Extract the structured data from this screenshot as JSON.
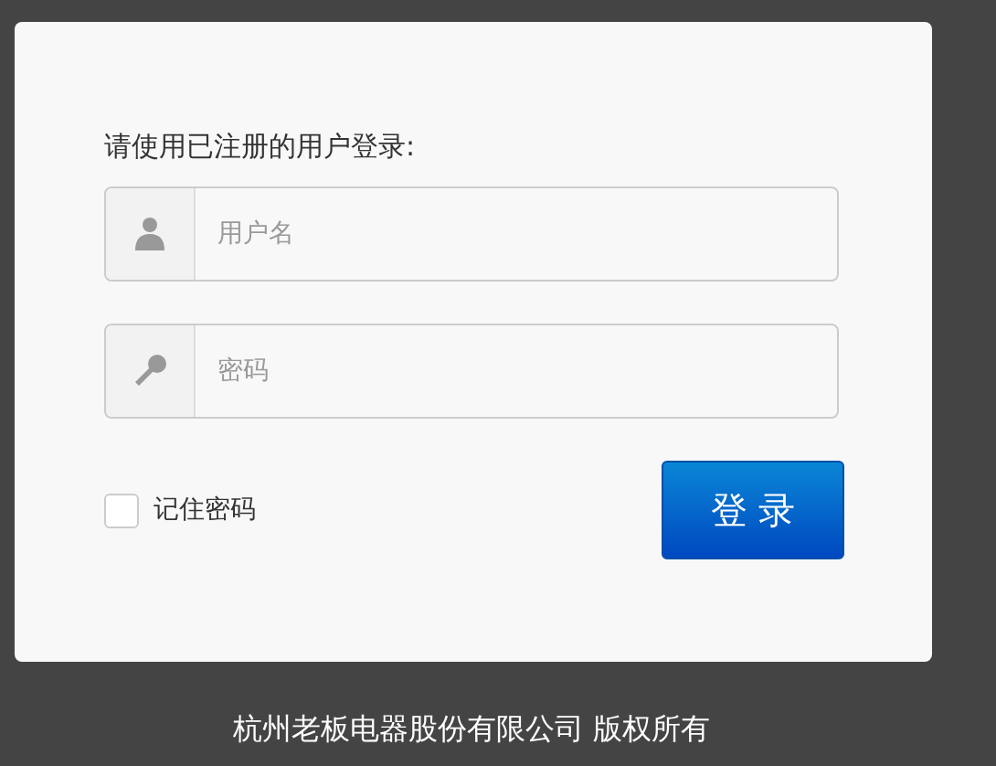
{
  "login": {
    "prompt": "请使用已注册的用户登录:",
    "fields": [
      {
        "kind": "user",
        "placeholder": "用户名"
      },
      {
        "kind": "password",
        "placeholder": "密码"
      }
    ],
    "remember": {
      "label": "记住密码",
      "checked": false
    },
    "submit": "登 录"
  },
  "footer": "杭州老板电器股份有限公司 版权所有"
}
